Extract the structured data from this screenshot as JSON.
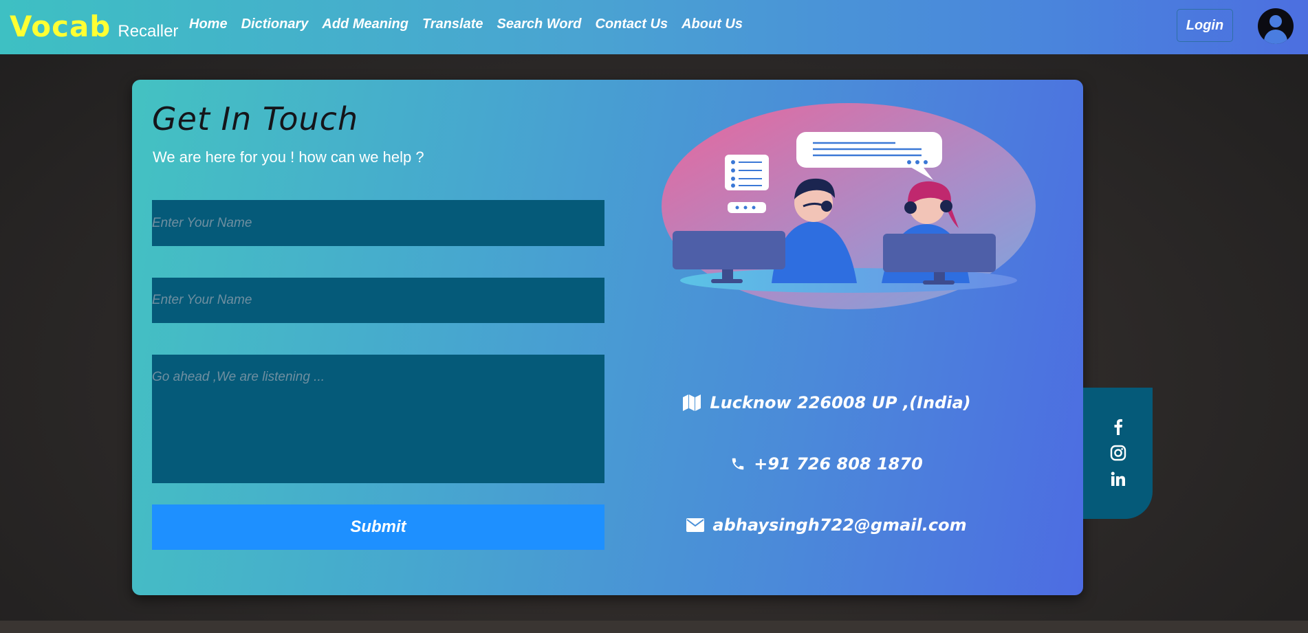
{
  "navbar": {
    "brand_main": "Vocab",
    "brand_sub": "Recaller",
    "links": [
      "Home",
      "Dictionary",
      "Add Meaning",
      "Translate",
      "Search Word",
      "Contact Us",
      "About Us"
    ],
    "login_label": "Login",
    "avatar_icon": "user-circle-icon"
  },
  "contact_form": {
    "title": "Get In Touch",
    "subtitle": "We are here for you ! how can we help ?",
    "name_placeholder": "Enter Your Name",
    "second_placeholder": "Enter Your Name",
    "message_placeholder": "Go ahead ,We are listening ...",
    "submit_label": "Submit"
  },
  "contact_info": {
    "address": "Lucknow  226008  UP ,(India)",
    "address_icon": "map-icon",
    "phone": "+91  726  808  1870",
    "phone_icon": "phone-icon",
    "email": "abhaysingh722@gmail.com",
    "email_icon": "envelope-icon"
  },
  "social": {
    "icons": [
      "facebook-icon",
      "instagram-icon",
      "linkedin-icon"
    ]
  },
  "colors": {
    "brand_yellow": "#ffff33",
    "input_bg": "#055a79",
    "submit_bg": "#1e90ff",
    "title_text": "#15151a"
  }
}
